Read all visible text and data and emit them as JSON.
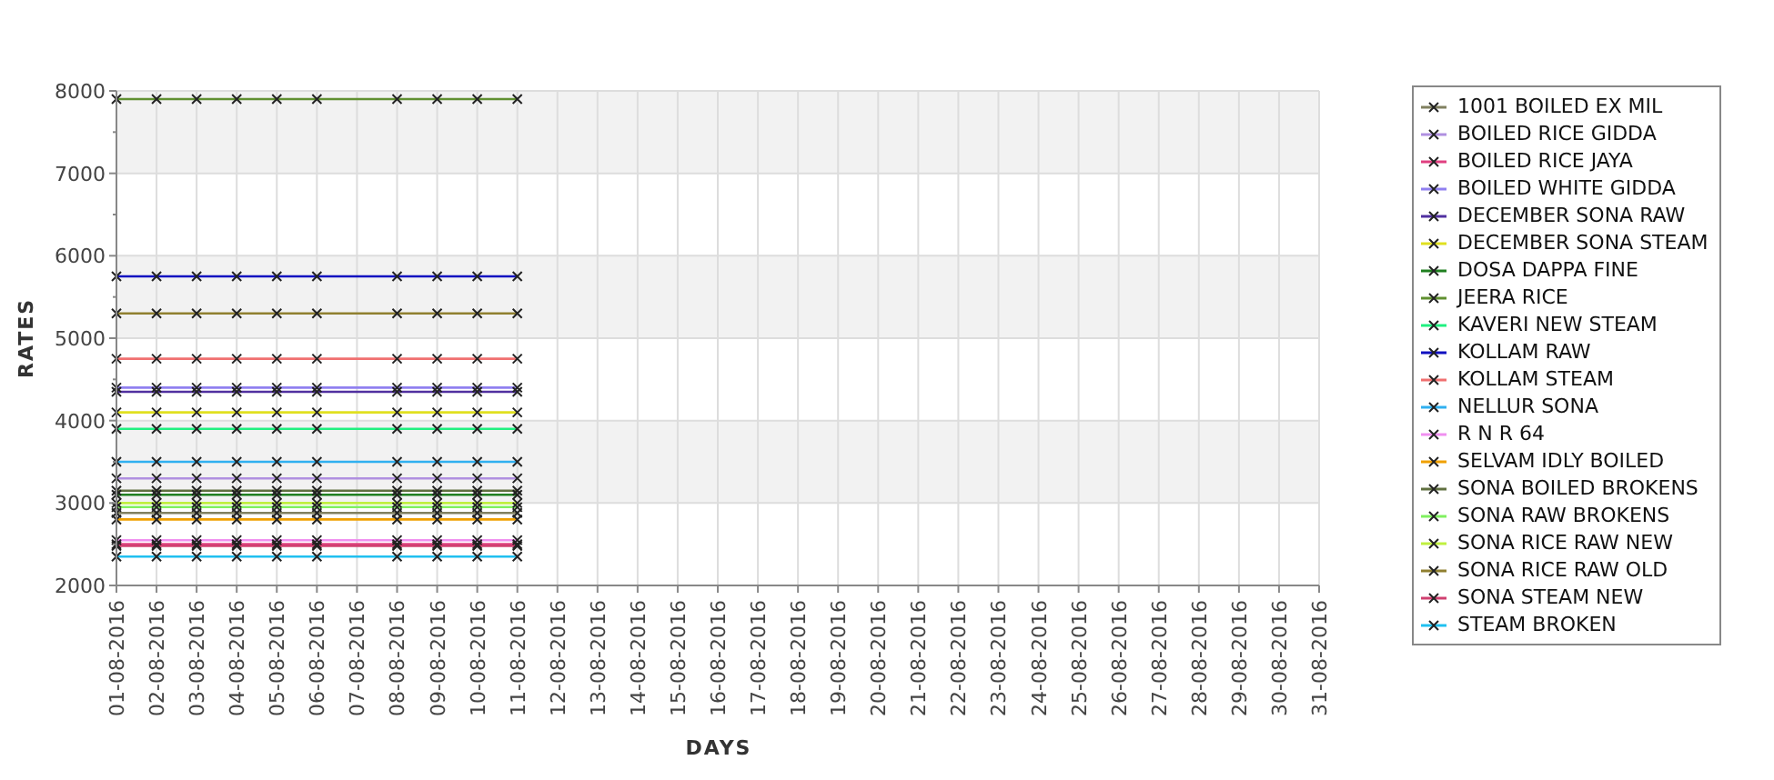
{
  "chart_data": {
    "type": "line",
    "xlabel": "DAYS",
    "ylabel": "RATES",
    "categories": [
      "01-08-2016",
      "02-08-2016",
      "03-08-2016",
      "04-08-2016",
      "05-08-2016",
      "06-08-2016",
      "07-08-2016",
      "08-08-2016",
      "09-08-2016",
      "10-08-2016",
      "11-08-2016",
      "12-08-2016",
      "13-08-2016",
      "14-08-2016",
      "15-08-2016",
      "16-08-2016",
      "17-08-2016",
      "18-08-2016",
      "19-08-2016",
      "20-08-2016",
      "21-08-2016",
      "22-08-2016",
      "23-08-2016",
      "24-08-2016",
      "25-08-2016",
      "26-08-2016",
      "27-08-2016",
      "28-08-2016",
      "29-08-2016",
      "30-08-2016",
      "31-08-2016"
    ],
    "grid": true,
    "ylim": [
      2000,
      8000
    ],
    "yticks": [
      2000,
      3000,
      4000,
      5000,
      6000,
      7000,
      8000
    ],
    "series": [
      {
        "name": "1001 BOILED EX MIL",
        "color": "#808060",
        "marker": "x",
        "values": [
          2880,
          2880,
          2880,
          2880,
          2880,
          2880,
          null,
          2880,
          2880,
          2880,
          2880,
          null,
          null,
          null,
          null,
          null,
          null,
          null,
          null,
          null,
          null,
          null,
          null,
          null,
          null,
          null,
          null,
          null,
          null,
          null,
          null
        ]
      },
      {
        "name": "BOILED RICE GIDDA",
        "color": "#b090e0",
        "marker": "x",
        "values": [
          3300,
          3300,
          3300,
          3300,
          3300,
          3300,
          null,
          3300,
          3300,
          3300,
          3300,
          null,
          null,
          null,
          null,
          null,
          null,
          null,
          null,
          null,
          null,
          null,
          null,
          null,
          null,
          null,
          null,
          null,
          null,
          null,
          null
        ]
      },
      {
        "name": "BOILED RICE JAYA",
        "color": "#e04080",
        "marker": "x",
        "values": [
          2500,
          2500,
          2500,
          2500,
          2500,
          2500,
          null,
          2500,
          2500,
          2500,
          2500,
          null,
          null,
          null,
          null,
          null,
          null,
          null,
          null,
          null,
          null,
          null,
          null,
          null,
          null,
          null,
          null,
          null,
          null,
          null,
          null
        ]
      },
      {
        "name": "BOILED WHITE GIDDA",
        "color": "#9080f0",
        "marker": "x",
        "values": [
          4400,
          4400,
          4400,
          4400,
          4400,
          4400,
          null,
          4400,
          4400,
          4400,
          4400,
          null,
          null,
          null,
          null,
          null,
          null,
          null,
          null,
          null,
          null,
          null,
          null,
          null,
          null,
          null,
          null,
          null,
          null,
          null,
          null
        ]
      },
      {
        "name": "DECEMBER SONA RAW",
        "color": "#5030a0",
        "marker": "x",
        "values": [
          4350,
          4350,
          4350,
          4350,
          4350,
          4350,
          null,
          4350,
          4350,
          4350,
          4350,
          null,
          null,
          null,
          null,
          null,
          null,
          null,
          null,
          null,
          null,
          null,
          null,
          null,
          null,
          null,
          null,
          null,
          null,
          null,
          null
        ]
      },
      {
        "name": "DECEMBER SONA STEAM",
        "color": "#e0e020",
        "marker": "x",
        "values": [
          4100,
          4100,
          4100,
          4100,
          4100,
          4100,
          null,
          4100,
          4100,
          4100,
          4100,
          null,
          null,
          null,
          null,
          null,
          null,
          null,
          null,
          null,
          null,
          null,
          null,
          null,
          null,
          null,
          null,
          null,
          null,
          null,
          null
        ]
      },
      {
        "name": "DOSA DAPPA FINE",
        "color": "#208020",
        "marker": "x",
        "values": [
          3100,
          3100,
          3100,
          3100,
          3100,
          3100,
          null,
          3100,
          3100,
          3100,
          3100,
          null,
          null,
          null,
          null,
          null,
          null,
          null,
          null,
          null,
          null,
          null,
          null,
          null,
          null,
          null,
          null,
          null,
          null,
          null,
          null
        ]
      },
      {
        "name": "JEERA RICE",
        "color": "#609030",
        "marker": "x",
        "values": [
          7900,
          7900,
          7900,
          7900,
          7900,
          7900,
          null,
          7900,
          7900,
          7900,
          7900,
          null,
          null,
          null,
          null,
          null,
          null,
          null,
          null,
          null,
          null,
          null,
          null,
          null,
          null,
          null,
          null,
          null,
          null,
          null,
          null
        ]
      },
      {
        "name": "KAVERI NEW STEAM",
        "color": "#20f080",
        "marker": "x",
        "values": [
          3900,
          3900,
          3900,
          3900,
          3900,
          3900,
          null,
          3900,
          3900,
          3900,
          3900,
          null,
          null,
          null,
          null,
          null,
          null,
          null,
          null,
          null,
          null,
          null,
          null,
          null,
          null,
          null,
          null,
          null,
          null,
          null,
          null
        ]
      },
      {
        "name": "KOLLAM RAW",
        "color": "#1010c0",
        "marker": "x",
        "values": [
          5750,
          5750,
          5750,
          5750,
          5750,
          5750,
          null,
          5750,
          5750,
          5750,
          5750,
          null,
          null,
          null,
          null,
          null,
          null,
          null,
          null,
          null,
          null,
          null,
          null,
          null,
          null,
          null,
          null,
          null,
          null,
          null,
          null
        ]
      },
      {
        "name": "KOLLAM STEAM",
        "color": "#f07070",
        "marker": "x",
        "values": [
          4750,
          4750,
          4750,
          4750,
          4750,
          4750,
          null,
          4750,
          4750,
          4750,
          4750,
          null,
          null,
          null,
          null,
          null,
          null,
          null,
          null,
          null,
          null,
          null,
          null,
          null,
          null,
          null,
          null,
          null,
          null,
          null,
          null
        ]
      },
      {
        "name": "NELLUR SONA",
        "color": "#30b0f0",
        "marker": "x",
        "values": [
          3500,
          3500,
          3500,
          3500,
          3500,
          3500,
          null,
          3500,
          3500,
          3500,
          3500,
          null,
          null,
          null,
          null,
          null,
          null,
          null,
          null,
          null,
          null,
          null,
          null,
          null,
          null,
          null,
          null,
          null,
          null,
          null,
          null
        ]
      },
      {
        "name": "R N R 64",
        "color": "#f090f0",
        "marker": "x",
        "values": [
          2550,
          2550,
          2550,
          2550,
          2550,
          2550,
          null,
          2550,
          2550,
          2550,
          2550,
          null,
          null,
          null,
          null,
          null,
          null,
          null,
          null,
          null,
          null,
          null,
          null,
          null,
          null,
          null,
          null,
          null,
          null,
          null,
          null
        ]
      },
      {
        "name": "SELVAM IDLY BOILED",
        "color": "#f0a000",
        "marker": "x",
        "values": [
          2800,
          2800,
          2800,
          2800,
          2800,
          2800,
          null,
          2800,
          2800,
          2800,
          2800,
          null,
          null,
          null,
          null,
          null,
          null,
          null,
          null,
          null,
          null,
          null,
          null,
          null,
          null,
          null,
          null,
          null,
          null,
          null,
          null
        ]
      },
      {
        "name": "SONA BOILED BROKENS",
        "color": "#607040",
        "marker": "x",
        "values": [
          3150,
          3150,
          3150,
          3150,
          3150,
          3150,
          null,
          3150,
          3150,
          3150,
          3150,
          null,
          null,
          null,
          null,
          null,
          null,
          null,
          null,
          null,
          null,
          null,
          null,
          null,
          null,
          null,
          null,
          null,
          null,
          null,
          null
        ]
      },
      {
        "name": "SONA RAW BROKENS",
        "color": "#80f060",
        "marker": "x",
        "values": [
          2950,
          2950,
          2950,
          2950,
          2950,
          2950,
          null,
          2950,
          2950,
          2950,
          2950,
          null,
          null,
          null,
          null,
          null,
          null,
          null,
          null,
          null,
          null,
          null,
          null,
          null,
          null,
          null,
          null,
          null,
          null,
          null,
          null
        ]
      },
      {
        "name": "SONA RICE RAW NEW",
        "color": "#c0f040",
        "marker": "x",
        "values": [
          3000,
          3000,
          3000,
          3000,
          3000,
          3000,
          null,
          3000,
          3000,
          3000,
          3000,
          null,
          null,
          null,
          null,
          null,
          null,
          null,
          null,
          null,
          null,
          null,
          null,
          null,
          null,
          null,
          null,
          null,
          null,
          null,
          null
        ]
      },
      {
        "name": "SONA RICE RAW OLD",
        "color": "#908030",
        "marker": "x",
        "values": [
          5300,
          5300,
          5300,
          5300,
          5300,
          5300,
          null,
          5300,
          5300,
          5300,
          5300,
          null,
          null,
          null,
          null,
          null,
          null,
          null,
          null,
          null,
          null,
          null,
          null,
          null,
          null,
          null,
          null,
          null,
          null,
          null,
          null
        ]
      },
      {
        "name": "SONA STEAM NEW",
        "color": "#d04070",
        "marker": "x",
        "values": [
          2480,
          2480,
          2480,
          2480,
          2480,
          2480,
          null,
          2480,
          2480,
          2480,
          2480,
          null,
          null,
          null,
          null,
          null,
          null,
          null,
          null,
          null,
          null,
          null,
          null,
          null,
          null,
          null,
          null,
          null,
          null,
          null,
          null
        ]
      },
      {
        "name": "STEAM BROKEN",
        "color": "#20c0f0",
        "marker": "x",
        "values": [
          2350,
          2350,
          2350,
          2350,
          2350,
          2350,
          null,
          2350,
          2350,
          2350,
          2350,
          null,
          null,
          null,
          null,
          null,
          null,
          null,
          null,
          null,
          null,
          null,
          null,
          null,
          null,
          null,
          null,
          null,
          null,
          null,
          null
        ]
      }
    ]
  }
}
